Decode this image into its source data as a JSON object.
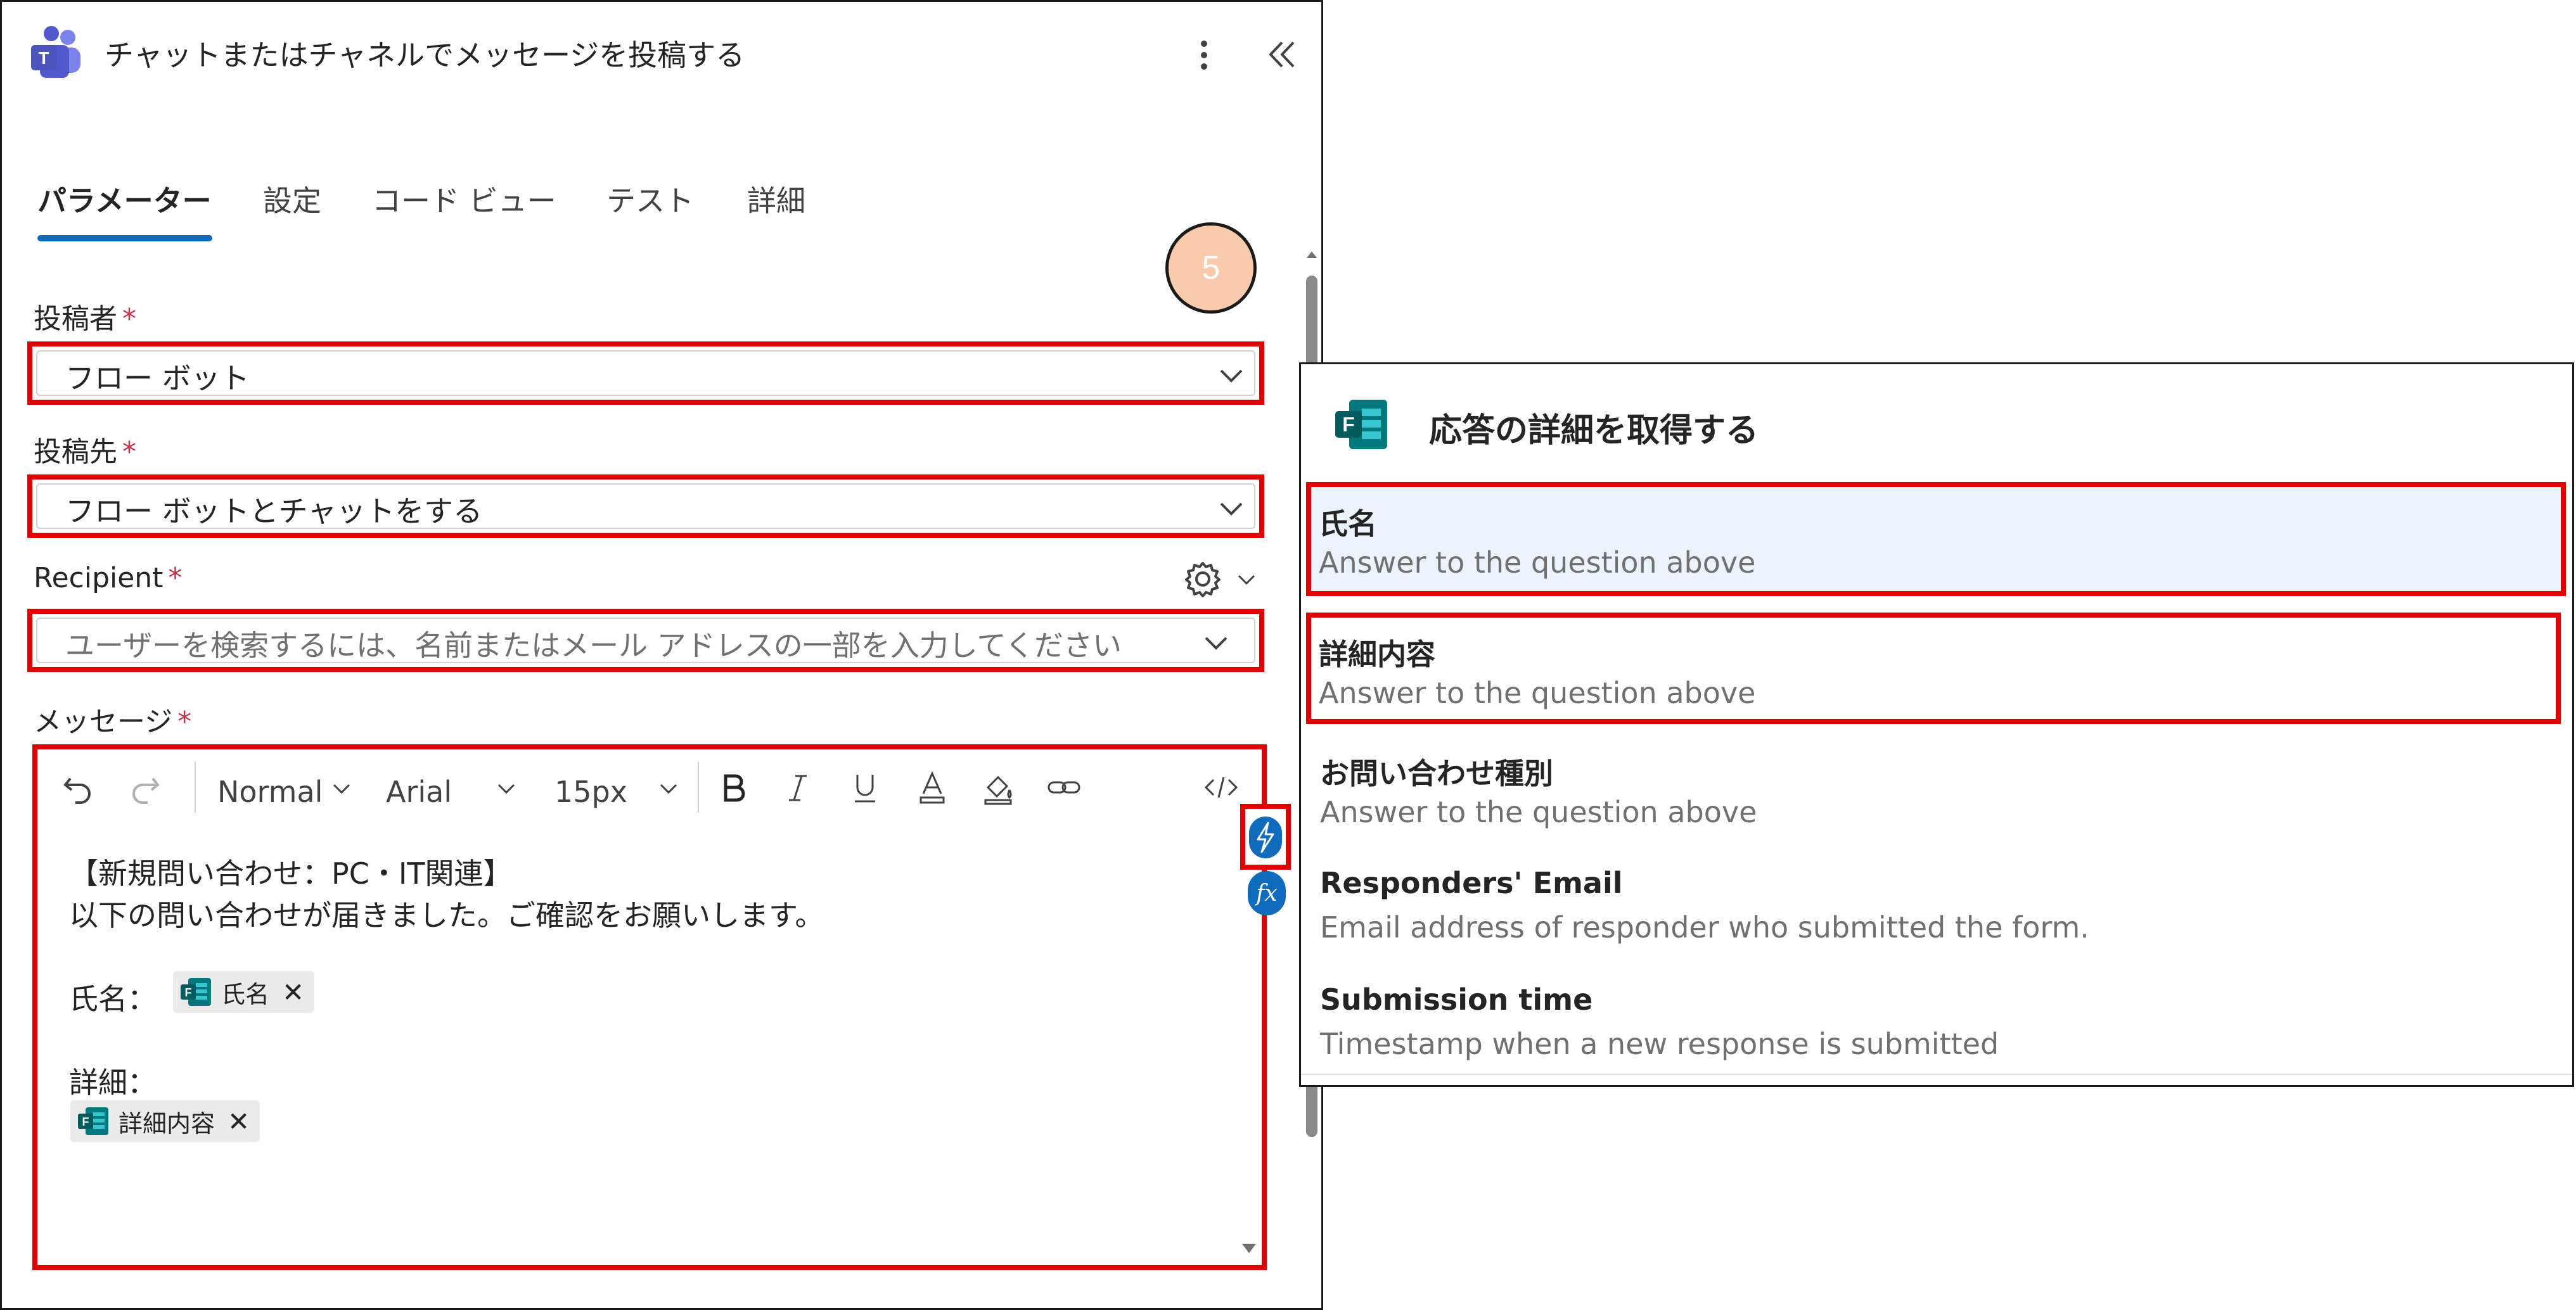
{
  "header": {
    "title": "チャットまたはチャネルでメッセージを投稿する"
  },
  "tabs": [
    "パラメーター",
    "設定",
    "コード ビュー",
    "テスト",
    "詳細"
  ],
  "step_badge": "5",
  "fields": {
    "poster": {
      "label": "投稿者",
      "required": "*",
      "value": "フロー ボット"
    },
    "post_in": {
      "label": "投稿先",
      "required": "*",
      "value": "フロー ボットとチャットをする"
    },
    "recipient": {
      "label": "Recipient",
      "required": "*",
      "placeholder": "ユーザーを検索するには、名前またはメール アドレスの一部を入力してください"
    },
    "message": {
      "label": "メッセージ",
      "required": "*"
    }
  },
  "toolbar": {
    "style": "Normal",
    "font": "Arial",
    "size": "15px"
  },
  "message_content": {
    "line1": "【新規問い合わせ：PC・IT関連】",
    "line2": "以下の問い合わせが届きました。ご確認をお願いします。",
    "name_label": "氏名：",
    "name_token": "氏名",
    "detail_label": "詳細：",
    "detail_token": "詳細内容",
    "token_close": "✕"
  },
  "fx_label": "fx",
  "popup": {
    "title": "応答の詳細を取得する",
    "options": [
      {
        "name": "氏名",
        "desc": "Answer to the question above"
      },
      {
        "name": "詳細内容",
        "desc": "Answer to the question above"
      },
      {
        "name": "お問い合わせ種別",
        "desc": "Answer to the question above"
      },
      {
        "name": "Responders' Email",
        "desc": "Email address of responder who submitted the form."
      },
      {
        "name": "Submission time",
        "desc": "Timestamp when a new response is submitted"
      }
    ]
  },
  "colors": {
    "accent": "#0f6cbd",
    "highlight_box": "#e00000",
    "badge_fill": "#f8cbad",
    "required": "#c4314b",
    "selected_row": "#ebf3fc"
  }
}
